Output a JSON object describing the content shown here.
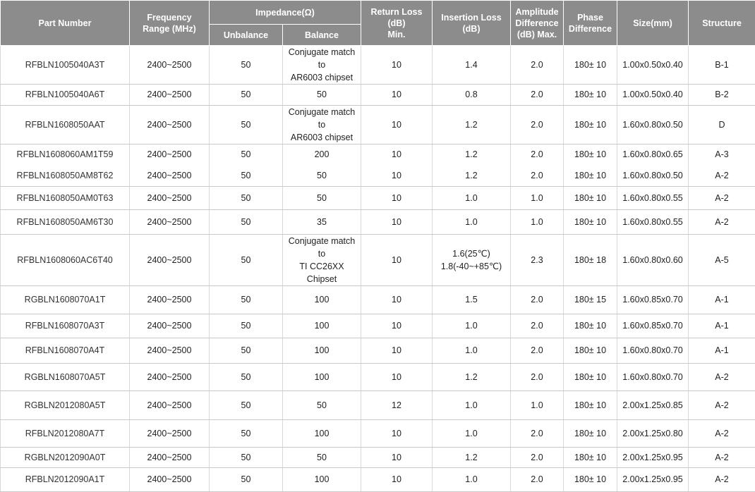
{
  "header": {
    "part_number": "Part Number",
    "frequency_line1": "Frequency",
    "frequency_line2": "Range (MHz)",
    "impedance": "Impedance(Ω)",
    "unbalance": "Unbalance",
    "balance": "Balance",
    "return_loss_line1": "Return Loss (dB)",
    "return_loss_line2": "Min.",
    "insertion_loss_line1": "Insertion Loss",
    "insertion_loss_line2": "(dB)",
    "amplitude_line1": "Amplitude",
    "amplitude_line2": "Difference",
    "amplitude_line3": "(dB) Max.",
    "phase_line1": "Phase",
    "phase_line2": "Difference",
    "size": "Size(mm)",
    "structure": "Structure"
  },
  "rows": [
    {
      "part": "RFBLN1005040A3T",
      "freq": "2400~2500",
      "unbal": "50",
      "bal1": "Conjugate match to",
      "bal2": "AR6003 chipset",
      "ret": "10",
      "ins1": "1.4",
      "ins2": "",
      "amp": "2.0",
      "phase": "180± 10",
      "size": "1.00x0.50x0.40",
      "struct": "B-1"
    },
    {
      "part": "RFBLN1005040A6T",
      "freq": "2400~2500",
      "unbal": "50",
      "bal1": "50",
      "bal2": "",
      "ret": "10",
      "ins1": "0.8",
      "ins2": "",
      "amp": "2.0",
      "phase": "180± 10",
      "size": "1.00x0.50x0.40",
      "struct": "B-2"
    },
    {
      "part": "RFBLN1608050AAT",
      "freq": "2400~2500",
      "unbal": "50",
      "bal1": "Conjugate match to",
      "bal2": "AR6003 chipset",
      "ret": "10",
      "ins1": "1.2",
      "ins2": "",
      "amp": "2.0",
      "phase": "180± 10",
      "size": "1.60x0.80x0.50",
      "struct": "D"
    },
    {
      "part": "RFBLN1608060AM1T59",
      "freq": "2400~2500",
      "unbal": "50",
      "bal1": "200",
      "bal2": "",
      "ret": "10",
      "ins1": "1.2",
      "ins2": "",
      "amp": "2.0",
      "phase": "180± 10",
      "size": "1.60x0.80x0.65",
      "struct": "A-3"
    },
    {
      "part": "RFBLN1608050AM8T62",
      "freq": "2400~2500",
      "unbal": "50",
      "bal1": "50",
      "bal2": "",
      "ret": "10",
      "ins1": "1.2",
      "ins2": "",
      "amp": "2.0",
      "phase": "180± 10",
      "size": "1.60x0.80x0.50",
      "struct": "A-2"
    },
    {
      "part": "RFBLN1608050AM0T63",
      "freq": "2400~2500",
      "unbal": "50",
      "bal1": "50",
      "bal2": "",
      "ret": "10",
      "ins1": "1.0",
      "ins2": "",
      "amp": "1.0",
      "phase": "180± 10",
      "size": "1.60x0.80x0.55",
      "struct": "A-2"
    },
    {
      "part": "RFBLN1608050AM6T30",
      "freq": "2400~2500",
      "unbal": "50",
      "bal1": "35",
      "bal2": "",
      "ret": "10",
      "ins1": "1.0",
      "ins2": "",
      "amp": "1.0",
      "phase": "180± 10",
      "size": "1.60x0.80x0.55",
      "struct": "A-2"
    },
    {
      "part": "RFBLN1608060AC6T40",
      "freq": "2400~2500",
      "unbal": "50",
      "bal1": "Conjugate match to",
      "bal2": "TI CC26XX Chipset",
      "ret": "10",
      "ins1": "1.6(25℃)",
      "ins2": "1.8(-40~+85℃)",
      "amp": "2.3",
      "phase": "180± 18",
      "size": "1.60x0.80x0.60",
      "struct": "A-5"
    },
    {
      "part": "RGBLN1608070A1T",
      "freq": "2400~2500",
      "unbal": "50",
      "bal1": "100",
      "bal2": "",
      "ret": "10",
      "ins1": "1.5",
      "ins2": "",
      "amp": "2.0",
      "phase": "180± 15",
      "size": "1.60x0.85x0.70",
      "struct": "A-1"
    },
    {
      "part": "RFBLN1608070A3T",
      "freq": "2400~2500",
      "unbal": "50",
      "bal1": "100",
      "bal2": "",
      "ret": "10",
      "ins1": "1.0",
      "ins2": "",
      "amp": "2.0",
      "phase": "180± 10",
      "size": "1.60x0.85x0.70",
      "struct": "A-1"
    },
    {
      "part": "RFBLN1608070A4T",
      "freq": "2400~2500",
      "unbal": "50",
      "bal1": "100",
      "bal2": "",
      "ret": "10",
      "ins1": "1.0",
      "ins2": "",
      "amp": "2.0",
      "phase": "180± 10",
      "size": "1.60x0.80x0.70",
      "struct": "A-1"
    },
    {
      "part": "RGBLN1608070A5T",
      "freq": "2400~2500",
      "unbal": "50",
      "bal1": "100",
      "bal2": "",
      "ret": "10",
      "ins1": "1.2",
      "ins2": "",
      "amp": "2.0",
      "phase": "180± 10",
      "size": "1.60x0.80x0.70",
      "struct": "A-2"
    },
    {
      "part": "RGBLN2012080A5T",
      "freq": "2400~2500",
      "unbal": "50",
      "bal1": "50",
      "bal2": "",
      "ret": "12",
      "ins1": "1.0",
      "ins2": "",
      "amp": "1.0",
      "phase": "180± 10",
      "size": "2.00x1.25x0.85",
      "struct": "A-2"
    },
    {
      "part": "RFBLN2012080A7T",
      "freq": "2400~2500",
      "unbal": "50",
      "bal1": "100",
      "bal2": "",
      "ret": "10",
      "ins1": "1.0",
      "ins2": "",
      "amp": "2.0",
      "phase": "180± 10",
      "size": "2.00x1.25x0.80",
      "struct": "A-2"
    },
    {
      "part": "RGBLN2012090A0T",
      "freq": "2400~2500",
      "unbal": "50",
      "bal1": "50",
      "bal2": "",
      "ret": "10",
      "ins1": "1.2",
      "ins2": "",
      "amp": "2.0",
      "phase": "180± 10",
      "size": "2.00x1.25x0.95",
      "struct": "A-2"
    },
    {
      "part": "RFBLN2012090A1T",
      "freq": "2400~2500",
      "unbal": "50",
      "bal1": "100",
      "bal2": "",
      "ret": "10",
      "ins1": "1.0",
      "ins2": "",
      "amp": "2.0",
      "phase": "180± 10",
      "size": "2.00x1.25x0.95",
      "struct": "A-2"
    }
  ]
}
